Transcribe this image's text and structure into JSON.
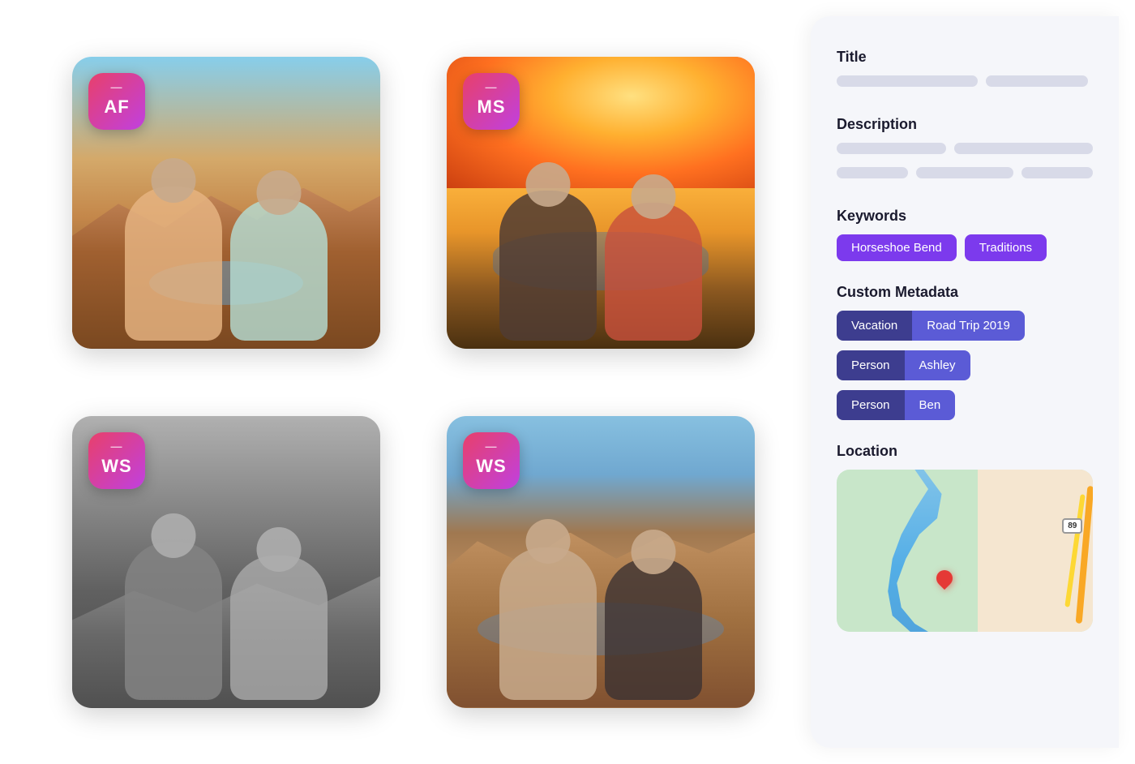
{
  "photos": [
    {
      "id": "photo-1",
      "badge": "AF",
      "theme": "canyon-selfie",
      "alt": "Couple selfie at Horseshoe Bend canyon"
    },
    {
      "id": "photo-2",
      "badge": "MS",
      "theme": "sunset-horseshoe",
      "alt": "Older couple at sunset Horseshoe Bend"
    },
    {
      "id": "photo-3",
      "badge": "WS",
      "theme": "vintage-bw",
      "alt": "Vintage black and white photo of two people"
    },
    {
      "id": "photo-4",
      "badge": "WS",
      "theme": "canyon-couple",
      "alt": "Couple at canyon overlook"
    }
  ],
  "sidebar": {
    "title_label": "Title",
    "description_label": "Description",
    "keywords_label": "Keywords",
    "custom_metadata_label": "Custom Metadata",
    "location_label": "Location",
    "keywords": [
      {
        "id": "kw-1",
        "label": "Horseshoe Bend"
      },
      {
        "id": "kw-2",
        "label": "Traditions"
      }
    ],
    "metadata_rows": [
      {
        "key": "Vacation",
        "value": "Road Trip 2019"
      },
      {
        "key": "Person",
        "value": "Ashley"
      },
      {
        "key": "Person",
        "value": "Ben"
      }
    ],
    "route_label": "89"
  }
}
